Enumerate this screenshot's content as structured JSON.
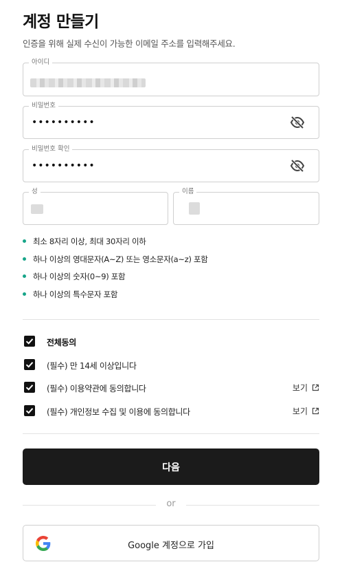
{
  "header": {
    "title": "계정 만들기",
    "subtitle": "인증을 위해 실제 수신이 가능한 이메일 주소를 입력해주세요."
  },
  "form": {
    "id": {
      "label": "아이디",
      "value_blurred": true
    },
    "password": {
      "label": "비밀번호",
      "value": "••••••••••",
      "visibility_icon": "eye-off-icon"
    },
    "password_confirm": {
      "label": "비밀번호 확인",
      "value": "••••••••••",
      "visibility_icon": "eye-off-icon"
    },
    "last_name": {
      "label": "성",
      "value_blurred": true
    },
    "first_name": {
      "label": "이름",
      "value_blurred": true
    }
  },
  "password_rules": [
    "최소 8자리 이상, 최대 30자리 이하",
    "하나 이상의 영대문자(A~Z) 또는 영소문자(a~z) 포함",
    "하나 이상의 숫자(0~9) 포함",
    "하나 이상의 특수문자 포함"
  ],
  "agreements": {
    "all": {
      "label": "전체동의",
      "checked": true
    },
    "items": [
      {
        "label": "(필수) 만 14세 이상입니다",
        "checked": true,
        "link": ""
      },
      {
        "label": "(필수) 이용약관에 동의합니다",
        "checked": true,
        "link": "보기"
      },
      {
        "label": "(필수) 개인정보 수집 및 이용에 동의합니다",
        "checked": true,
        "link": "보기"
      }
    ]
  },
  "actions": {
    "next_label": "다음",
    "or_label": "or",
    "google_label": "Google 계정으로 가입"
  },
  "colors": {
    "accent_dot": "#17a589",
    "primary_button": "#1b1b1b",
    "checkbox": "#111111"
  }
}
